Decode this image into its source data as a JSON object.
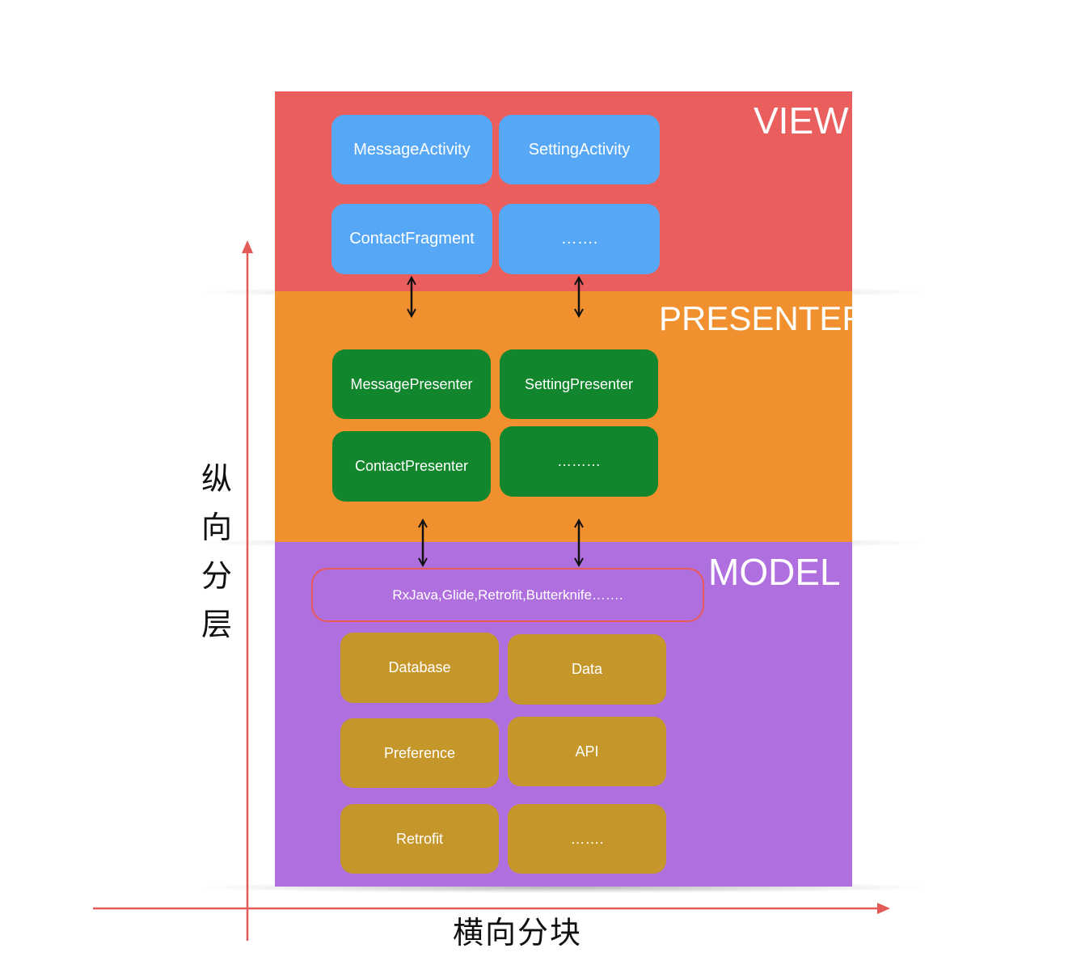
{
  "layers": {
    "view": {
      "title": "VIEW",
      "color": "#ea5f5e",
      "boxes": [
        "MessageActivity",
        "SettingActivity",
        "ContactFragment",
        "……."
      ]
    },
    "presenter": {
      "title": "PRESENTER",
      "color": "#f0902f",
      "boxes": [
        "MessagePresenter",
        "SettingPresenter",
        "ContactPresenter",
        "………"
      ]
    },
    "model": {
      "title": "MODEL",
      "color": "#b06fde",
      "libraries": "RxJava,Glide,Retrofit,Butterknife…….",
      "boxes": [
        "Database",
        "Data",
        "Preference",
        "API",
        "Retrofit",
        "……."
      ]
    }
  },
  "box_colors": {
    "view": "#56a8f7",
    "presenter": "#11862c",
    "model": "#c5972b",
    "library_border": "#e85a5a"
  },
  "axes": {
    "vertical_label": "纵向分层",
    "horizontal_label": "横向分块",
    "color": "#e35a57"
  }
}
